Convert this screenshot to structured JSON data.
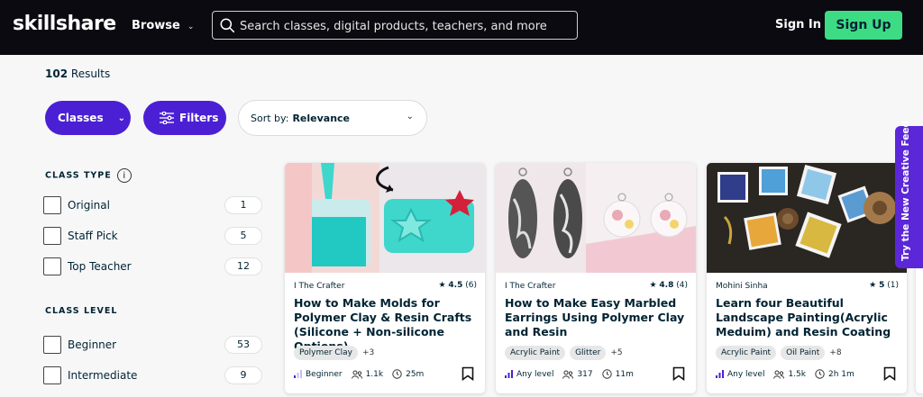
{
  "header": {
    "logo": "skillshare",
    "browse_label": "Browse",
    "search_placeholder": "Search classes, digital products, teachers, and more",
    "signin_label": "Sign In",
    "signup_label": "Sign Up"
  },
  "results": {
    "count": "102",
    "label": "Results"
  },
  "toolbar": {
    "classes_label": "Classes",
    "filters_label": "Filters",
    "sort_prefix": "Sort by:",
    "sort_value": "Relevance"
  },
  "filters": {
    "class_type": {
      "title": "CLASS TYPE",
      "info_glyph": "i",
      "options": [
        {
          "label": "Original",
          "count": "1"
        },
        {
          "label": "Staff Pick",
          "count": "5"
        },
        {
          "label": "Top Teacher",
          "count": "12"
        }
      ]
    },
    "class_level": {
      "title": "CLASS LEVEL",
      "options": [
        {
          "label": "Beginner",
          "count": "53"
        },
        {
          "label": "Intermediate",
          "count": "9"
        }
      ]
    }
  },
  "cards": [
    {
      "teacher": "I The Crafter",
      "rating": "4.5",
      "reviews": "(6)",
      "title": "How to Make Molds for Polymer Clay & Resin Crafts (Silicone + Non-silicone Options)",
      "tags": [
        "Polymer Clay"
      ],
      "more_tags": "+3",
      "level": "Beginner",
      "students": "1.1k",
      "duration": "25m"
    },
    {
      "teacher": "I The Crafter",
      "rating": "4.8",
      "reviews": "(4)",
      "title": "How to Make Easy Marbled Earrings Using Polymer Clay and Resin",
      "tags": [
        "Acrylic Paint",
        "Glitter"
      ],
      "more_tags": "+5",
      "level": "Any level",
      "students": "317",
      "duration": "11m"
    },
    {
      "teacher": "Mohini Sinha",
      "rating": "5",
      "reviews": "(1)",
      "title": "Learn four Beautiful Landscape Painting(Acrylic Meduim) and Resin Coating",
      "tags": [
        "Acrylic Paint",
        "Oil Paint"
      ],
      "more_tags": "+8",
      "level": "Any level",
      "students": "1.5k",
      "duration": "2h 1m"
    }
  ],
  "side_tab": {
    "label": "Try the New Creative Feed"
  },
  "colors": {
    "header_bg": "#0a0a10",
    "brand_purple": "#4b20d4",
    "signup_green": "#3ddc84"
  },
  "icons": [
    "search-icon",
    "chevron-down-icon",
    "filters-icon",
    "info-icon",
    "star-icon",
    "level-icon",
    "students-icon",
    "clock-icon",
    "bookmark-icon"
  ]
}
